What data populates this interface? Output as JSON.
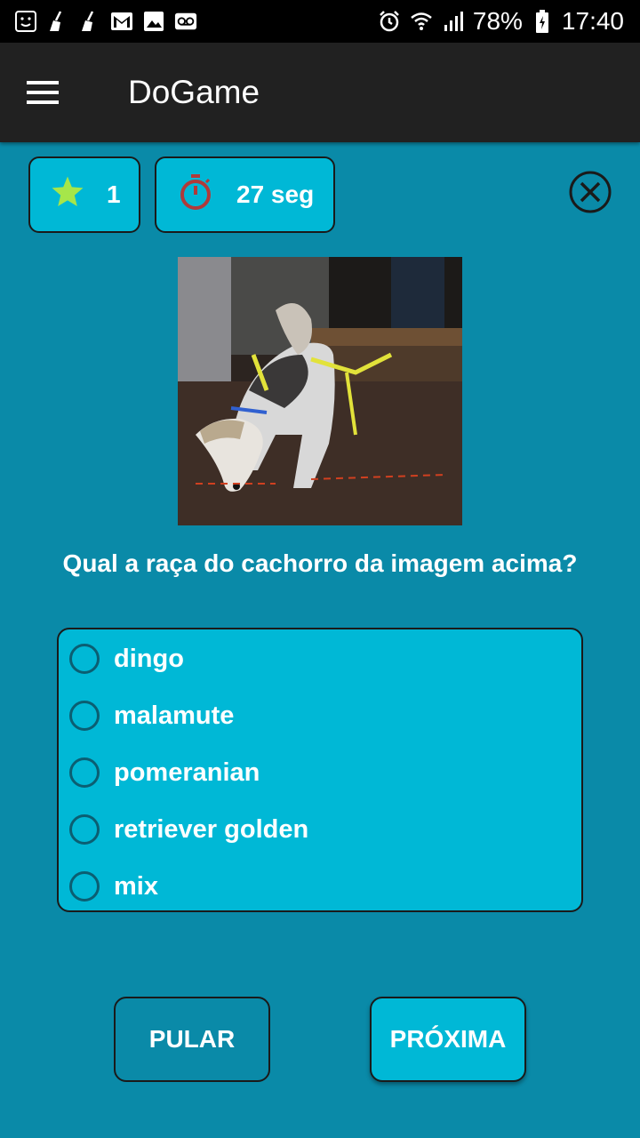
{
  "status_bar": {
    "battery": "78%",
    "time": "17:40",
    "icons": [
      "face-icon",
      "broom-icon",
      "broom-icon",
      "gmail-icon",
      "image-icon",
      "voicemail-icon",
      "alarm-icon",
      "wifi-icon",
      "signal-icon",
      "battery-icon"
    ]
  },
  "app_bar": {
    "title": "DoGame",
    "menu_icon": "hamburger-menu-icon"
  },
  "stats": {
    "score": "1",
    "score_icon": "star-icon",
    "timer": "27 seg",
    "timer_icon": "stopwatch-icon"
  },
  "close_icon": "close-circle-icon",
  "question": "Qual a raça do cachorro da imagem acima?",
  "options": [
    {
      "label": "dingo"
    },
    {
      "label": "malamute"
    },
    {
      "label": "pomeranian"
    },
    {
      "label": "retriever golden"
    },
    {
      "label": "mix"
    }
  ],
  "buttons": {
    "skip": "PULAR",
    "next": "PRÓXIMA"
  },
  "colors": {
    "background": "#0a8aa8",
    "accent": "#00b8d6",
    "app_bar": "#212121",
    "star": "#a6e64a",
    "timer": "#b03a3a"
  }
}
